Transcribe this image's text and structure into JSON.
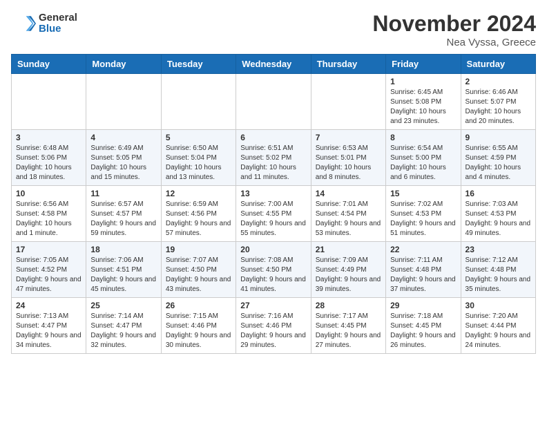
{
  "header": {
    "logo_general": "General",
    "logo_blue": "Blue",
    "month_title": "November 2024",
    "location": "Nea Vyssa, Greece"
  },
  "weekdays": [
    "Sunday",
    "Monday",
    "Tuesday",
    "Wednesday",
    "Thursday",
    "Friday",
    "Saturday"
  ],
  "weeks": [
    [
      {
        "day": "",
        "info": ""
      },
      {
        "day": "",
        "info": ""
      },
      {
        "day": "",
        "info": ""
      },
      {
        "day": "",
        "info": ""
      },
      {
        "day": "",
        "info": ""
      },
      {
        "day": "1",
        "info": "Sunrise: 6:45 AM\nSunset: 5:08 PM\nDaylight: 10 hours and 23 minutes."
      },
      {
        "day": "2",
        "info": "Sunrise: 6:46 AM\nSunset: 5:07 PM\nDaylight: 10 hours and 20 minutes."
      }
    ],
    [
      {
        "day": "3",
        "info": "Sunrise: 6:48 AM\nSunset: 5:06 PM\nDaylight: 10 hours and 18 minutes."
      },
      {
        "day": "4",
        "info": "Sunrise: 6:49 AM\nSunset: 5:05 PM\nDaylight: 10 hours and 15 minutes."
      },
      {
        "day": "5",
        "info": "Sunrise: 6:50 AM\nSunset: 5:04 PM\nDaylight: 10 hours and 13 minutes."
      },
      {
        "day": "6",
        "info": "Sunrise: 6:51 AM\nSunset: 5:02 PM\nDaylight: 10 hours and 11 minutes."
      },
      {
        "day": "7",
        "info": "Sunrise: 6:53 AM\nSunset: 5:01 PM\nDaylight: 10 hours and 8 minutes."
      },
      {
        "day": "8",
        "info": "Sunrise: 6:54 AM\nSunset: 5:00 PM\nDaylight: 10 hours and 6 minutes."
      },
      {
        "day": "9",
        "info": "Sunrise: 6:55 AM\nSunset: 4:59 PM\nDaylight: 10 hours and 4 minutes."
      }
    ],
    [
      {
        "day": "10",
        "info": "Sunrise: 6:56 AM\nSunset: 4:58 PM\nDaylight: 10 hours and 1 minute."
      },
      {
        "day": "11",
        "info": "Sunrise: 6:57 AM\nSunset: 4:57 PM\nDaylight: 9 hours and 59 minutes."
      },
      {
        "day": "12",
        "info": "Sunrise: 6:59 AM\nSunset: 4:56 PM\nDaylight: 9 hours and 57 minutes."
      },
      {
        "day": "13",
        "info": "Sunrise: 7:00 AM\nSunset: 4:55 PM\nDaylight: 9 hours and 55 minutes."
      },
      {
        "day": "14",
        "info": "Sunrise: 7:01 AM\nSunset: 4:54 PM\nDaylight: 9 hours and 53 minutes."
      },
      {
        "day": "15",
        "info": "Sunrise: 7:02 AM\nSunset: 4:53 PM\nDaylight: 9 hours and 51 minutes."
      },
      {
        "day": "16",
        "info": "Sunrise: 7:03 AM\nSunset: 4:53 PM\nDaylight: 9 hours and 49 minutes."
      }
    ],
    [
      {
        "day": "17",
        "info": "Sunrise: 7:05 AM\nSunset: 4:52 PM\nDaylight: 9 hours and 47 minutes."
      },
      {
        "day": "18",
        "info": "Sunrise: 7:06 AM\nSunset: 4:51 PM\nDaylight: 9 hours and 45 minutes."
      },
      {
        "day": "19",
        "info": "Sunrise: 7:07 AM\nSunset: 4:50 PM\nDaylight: 9 hours and 43 minutes."
      },
      {
        "day": "20",
        "info": "Sunrise: 7:08 AM\nSunset: 4:50 PM\nDaylight: 9 hours and 41 minutes."
      },
      {
        "day": "21",
        "info": "Sunrise: 7:09 AM\nSunset: 4:49 PM\nDaylight: 9 hours and 39 minutes."
      },
      {
        "day": "22",
        "info": "Sunrise: 7:11 AM\nSunset: 4:48 PM\nDaylight: 9 hours and 37 minutes."
      },
      {
        "day": "23",
        "info": "Sunrise: 7:12 AM\nSunset: 4:48 PM\nDaylight: 9 hours and 35 minutes."
      }
    ],
    [
      {
        "day": "24",
        "info": "Sunrise: 7:13 AM\nSunset: 4:47 PM\nDaylight: 9 hours and 34 minutes."
      },
      {
        "day": "25",
        "info": "Sunrise: 7:14 AM\nSunset: 4:47 PM\nDaylight: 9 hours and 32 minutes."
      },
      {
        "day": "26",
        "info": "Sunrise: 7:15 AM\nSunset: 4:46 PM\nDaylight: 9 hours and 30 minutes."
      },
      {
        "day": "27",
        "info": "Sunrise: 7:16 AM\nSunset: 4:46 PM\nDaylight: 9 hours and 29 minutes."
      },
      {
        "day": "28",
        "info": "Sunrise: 7:17 AM\nSunset: 4:45 PM\nDaylight: 9 hours and 27 minutes."
      },
      {
        "day": "29",
        "info": "Sunrise: 7:18 AM\nSunset: 4:45 PM\nDaylight: 9 hours and 26 minutes."
      },
      {
        "day": "30",
        "info": "Sunrise: 7:20 AM\nSunset: 4:44 PM\nDaylight: 9 hours and 24 minutes."
      }
    ]
  ]
}
